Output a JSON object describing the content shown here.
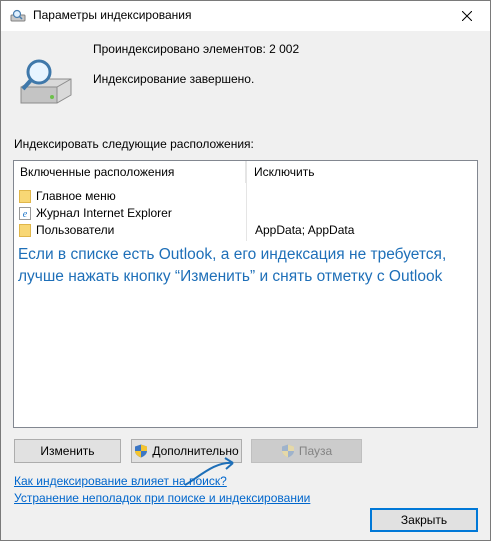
{
  "window": {
    "title": "Параметры индексирования"
  },
  "status": {
    "count_text": "Проиндексировано элементов: 2 002",
    "state_text": "Индексирование завершено."
  },
  "locations": {
    "label": "Индексировать следующие расположения:",
    "columns": {
      "included": "Включенные расположения",
      "exclude": "Исключить"
    },
    "rows": [
      {
        "name": "Главное меню",
        "exclude": "",
        "icon": "folder-icon"
      },
      {
        "name": "Журнал Internet Explorer",
        "exclude": "",
        "icon": "ie-icon"
      },
      {
        "name": "Пользователи",
        "exclude": "AppData; AppData",
        "icon": "folder-icon"
      }
    ]
  },
  "annotation": {
    "line1": "Если в списке есть Outlook, а его индексация не требуется,",
    "line2": "лучше нажать кнопку “Изменить” и снять отметку с Outlook"
  },
  "buttons": {
    "modify": "Изменить",
    "advanced": "Дополнительно",
    "pause": "Пауза",
    "close": "Закрыть"
  },
  "links": {
    "how_affects": "Как индексирование влияет на поиск?",
    "troubleshoot": "Устранение неполадок при поиске и индексировании"
  },
  "colors": {
    "annotation": "#1e6fb8",
    "link": "#0066cc",
    "accent": "#0078d7"
  }
}
